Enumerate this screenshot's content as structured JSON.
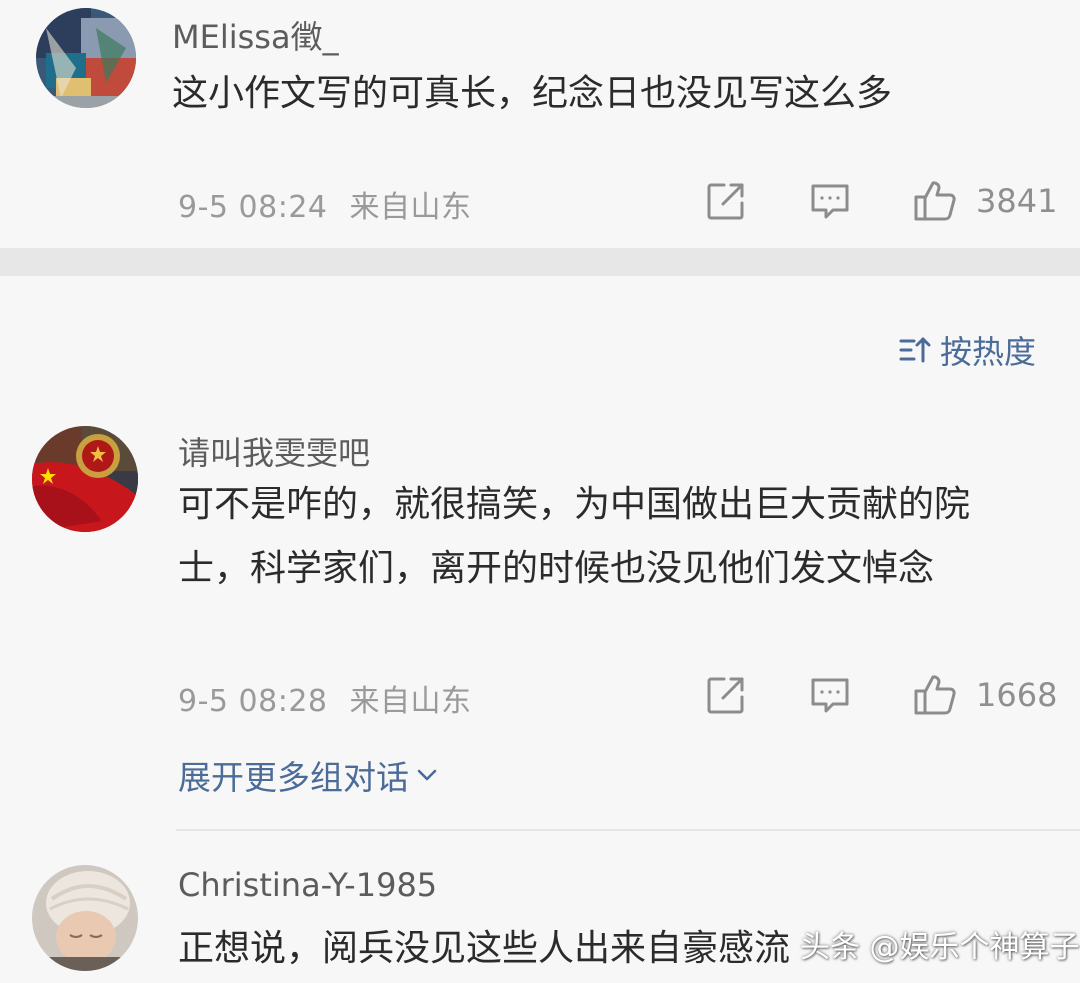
{
  "sort": {
    "label": "按热度"
  },
  "expand": {
    "label": "展开更多组对话"
  },
  "watermark": "头条 @娱乐个神算子",
  "comments": [
    {
      "username": "MElissa徵_",
      "content": "这小作文写的可真长，纪念日也没见写这么多",
      "time": "9-5 08:24",
      "location": "来自山东",
      "likes": "3841"
    },
    {
      "username": "请叫我雯雯吧",
      "content": "可不是咋的，就很搞笑，为中国做出巨大贡献的院士，科学家们，离开的时候也没见他们发文悼念",
      "time": "9-5 08:28",
      "location": "来自山东",
      "likes": "1668"
    },
    {
      "username": "Christina-Y-1985",
      "content": "正想说，阅兵没见这些人出来自豪感流"
    }
  ],
  "icons": {
    "share": "share-icon",
    "reply": "comment-icon",
    "like": "thumbs-up-icon",
    "sort": "sort-icon",
    "expand": "chevron-down-icon"
  },
  "colors": {
    "background": "#f7f7f7",
    "separator": "#e7e7e7",
    "link_blue": "#4b6b98",
    "meta_gray": "#9a9a9a",
    "text": "#2b2b2b"
  }
}
